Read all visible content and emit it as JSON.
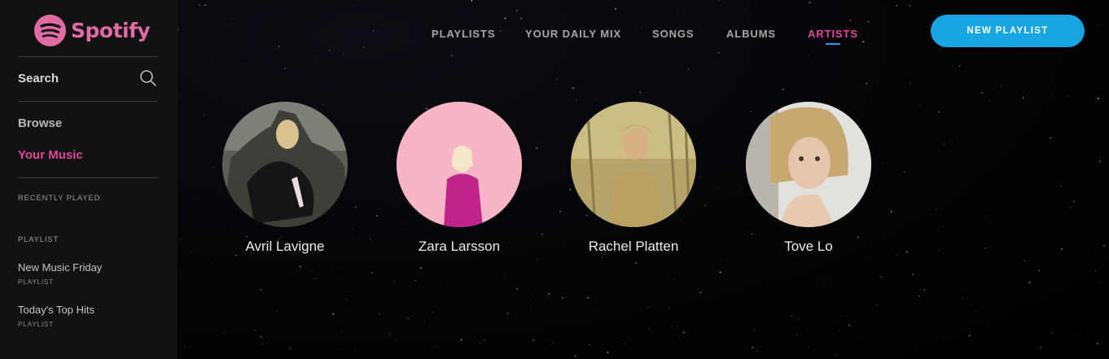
{
  "brand": {
    "name": "Spotify",
    "logo_icon": "spotify-logo-icon",
    "color": "#e26ba6"
  },
  "sidebar": {
    "search_label": "Search",
    "search_icon": "search-icon",
    "nav": [
      {
        "label": "Browse"
      },
      {
        "label": "Your Music",
        "active": true
      }
    ],
    "recently_played_heading": "RECENTLY PLAYED",
    "section_label": "PLAYLIST",
    "playlists": [
      {
        "title": "New Music Friday",
        "subtitle": "PLAYLIST"
      },
      {
        "title": "Today's Top Hits",
        "subtitle": "PLAYLIST"
      }
    ]
  },
  "header": {
    "tabs": [
      {
        "label": "PLAYLISTS"
      },
      {
        "label": "YOUR DAILY MIX"
      },
      {
        "label": "SONGS"
      },
      {
        "label": "ALBUMS"
      },
      {
        "label": "ARTISTS",
        "active": true
      }
    ],
    "new_playlist_label": "NEW PLAYLIST"
  },
  "artists": [
    {
      "name": "Avril Lavigne"
    },
    {
      "name": "Zara Larsson"
    },
    {
      "name": "Rachel Platten"
    },
    {
      "name": "Tove Lo"
    }
  ],
  "colors": {
    "accent": "#e0489d",
    "button": "#17a5e3",
    "underline": "#2d9bf0"
  }
}
